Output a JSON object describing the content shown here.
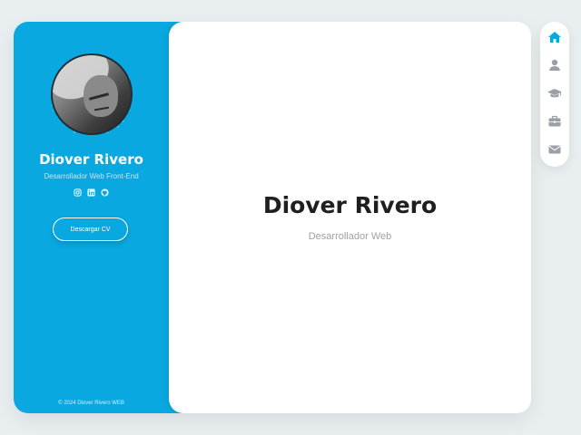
{
  "profile": {
    "name": "Diover Rivero",
    "role": "Desarrollador Web Front-End",
    "cv_button": "Descargar CV",
    "copyright": "© 2024 Diover Rivero WEB"
  },
  "socials": [
    {
      "icon": "instagram-icon"
    },
    {
      "icon": "linkedin-icon"
    },
    {
      "icon": "github-icon"
    }
  ],
  "main": {
    "title": "Diover Rivero",
    "subtitle": "Desarrollador Web"
  },
  "nav": {
    "items": [
      {
        "icon": "home-icon",
        "active": true
      },
      {
        "icon": "user-icon",
        "active": false
      },
      {
        "icon": "graduation-cap-icon",
        "active": false
      },
      {
        "icon": "briefcase-icon",
        "active": false
      },
      {
        "icon": "envelope-icon",
        "active": false
      }
    ]
  },
  "colors": {
    "accent": "#0aa8e0",
    "nav_inactive": "#9aa0a6",
    "title": "#1f1f1f",
    "subtitle": "#a0a0a0"
  }
}
